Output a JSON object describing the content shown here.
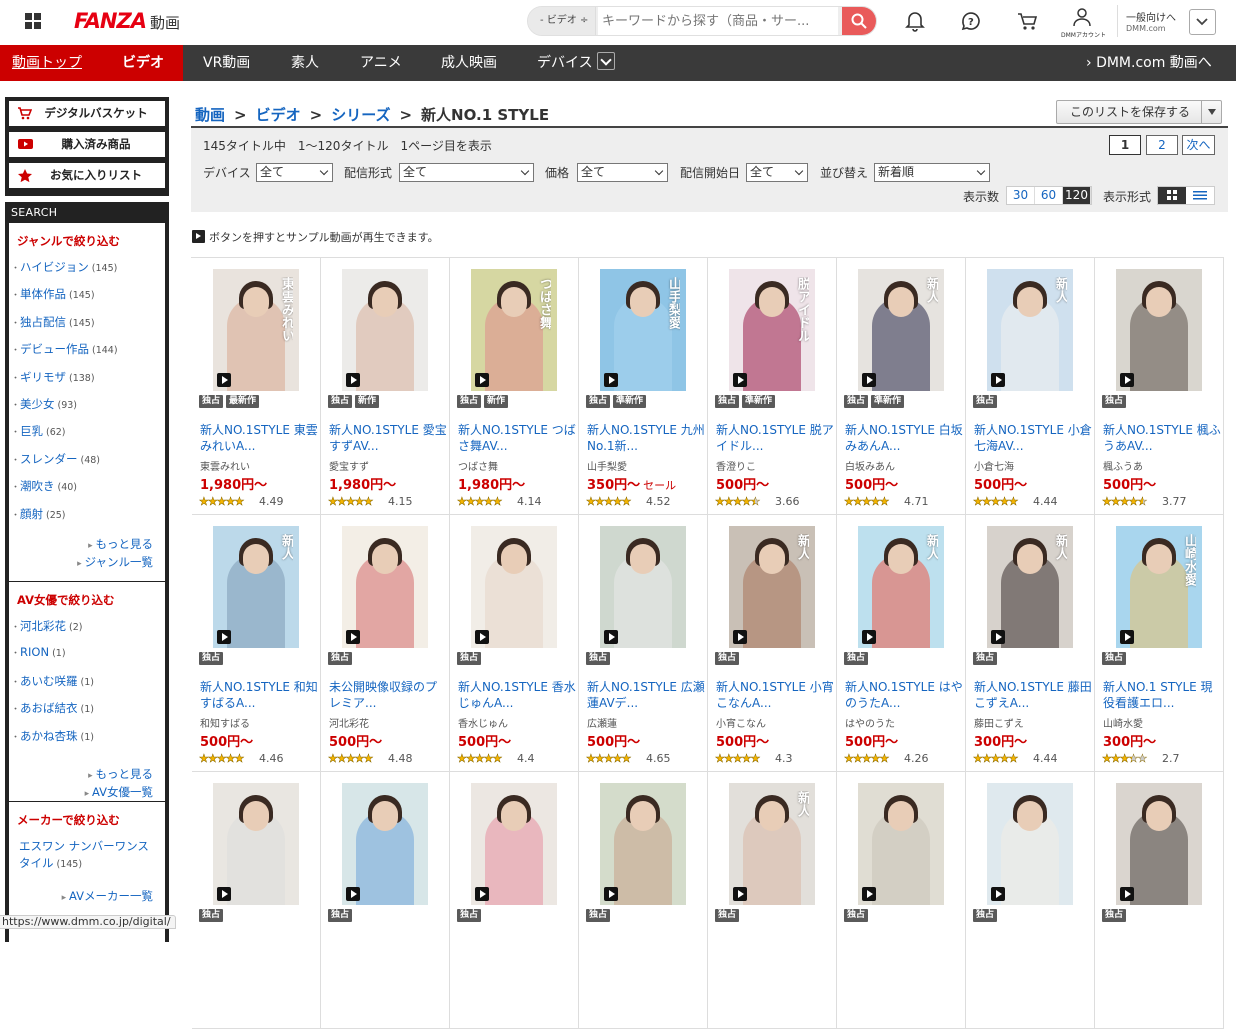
{
  "header": {
    "logo_main": "FANZA",
    "logo_sub": "動画",
    "search_category": "- ビデオ ÷",
    "search_placeholder": "キーワードから探す（商品・サー...",
    "account_label": "DMMアカウント",
    "general_line1": "一般向けへ",
    "general_line2": "DMM.com"
  },
  "nav": {
    "top": "動画トップ",
    "video": "ビデオ",
    "vr": "VR動画",
    "amateur": "素人",
    "anime": "アニメ",
    "adult_film": "成人映画",
    "device": "デバイス",
    "dmm": "DMM.com 動画へ"
  },
  "sidebar": {
    "basket": "デジタルバスケット",
    "purchased": "購入済み商品",
    "favorites": "お気に入りリスト",
    "search_label": "SEARCH",
    "genre_title": "ジャンルで絞り込む",
    "genres": [
      {
        "name": "ハイビジョン",
        "count": "(145)"
      },
      {
        "name": "単体作品",
        "count": "(145)"
      },
      {
        "name": "独占配信",
        "count": "(145)"
      },
      {
        "name": "デビュー作品",
        "count": "(144)"
      },
      {
        "name": "ギリモザ",
        "count": "(138)"
      },
      {
        "name": "美少女",
        "count": "(93)"
      },
      {
        "name": "巨乳",
        "count": "(62)"
      },
      {
        "name": "スレンダー",
        "count": "(48)"
      },
      {
        "name": "潮吹き",
        "count": "(40)"
      },
      {
        "name": "顔射",
        "count": "(25)"
      }
    ],
    "more": "もっと見る",
    "genre_list": "ジャンル一覧",
    "actress_title": "AV女優で絞り込む",
    "actresses": [
      {
        "name": "河北彩花",
        "count": "(2)"
      },
      {
        "name": "RION",
        "count": "(1)"
      },
      {
        "name": "あいむ咲羅",
        "count": "(1)"
      },
      {
        "name": "あおば結衣",
        "count": "(1)"
      },
      {
        "name": "あかね杏珠",
        "count": "(1)"
      }
    ],
    "actress_list": "AV女優一覧",
    "maker_title": "メーカーで絞り込む",
    "maker_name": "エスワン ナンバーワンスタイル",
    "maker_count": "(145)",
    "maker_list": "AVメーカー一覧"
  },
  "breadcrumb": {
    "a": "動画",
    "b": "ビデオ",
    "c": "シリーズ",
    "current": "新人NO.1 STYLE",
    "sep": ">"
  },
  "save_list": "このリストを保存する",
  "count_text": "145タイトル中　1〜120タイトル　1ページ目を表示",
  "pager": {
    "p1": "1",
    "p2": "2",
    "next": "次へ"
  },
  "filters": {
    "device_label": "デバイス",
    "device_val": "全て",
    "format_label": "配信形式",
    "format_val": "全て",
    "price_label": "価格",
    "price_val": "全て",
    "start_label": "配信開始日",
    "start_val": "全て",
    "sort_label": "並び替え",
    "sort_val": "新着順"
  },
  "display": {
    "count_label": "表示数",
    "opts": [
      "30",
      "60",
      "120"
    ],
    "format_label": "表示形式"
  },
  "note": "ボタンを押すとサンプル動画が再生できます。",
  "status_url": "https://www.dmm.co.jp/digital/",
  "products": [
    {
      "title": "新人NO.1STYLE 東雲みれいA...",
      "actress": "東雲みれい",
      "price": "1,980円〜",
      "sale": "",
      "rating": 4.49,
      "rating_text": "4.49",
      "badges": [
        "独占",
        "最新作"
      ],
      "cap": "東雲みれい",
      "bg": "#e9e3dd",
      "tone": "#d9a98f"
    },
    {
      "title": "新人NO.1STYLE 愛宝すずAV...",
      "actress": "愛宝すず",
      "price": "1,980円〜",
      "sale": "",
      "rating": 4.15,
      "rating_text": "4.15",
      "badges": [
        "独占",
        "新作"
      ],
      "cap": "",
      "bg": "#ecebe9",
      "tone": "#d8b19c"
    },
    {
      "title": "新人NO.1STYLE つばさ舞AV...",
      "actress": "つばさ舞",
      "price": "1,980円〜",
      "sale": "",
      "rating": 4.14,
      "rating_text": "4.14",
      "badges": [
        "独占",
        "新作"
      ],
      "cap": "つばさ舞",
      "bg": "#d6d7a2",
      "tone": "#e08c8c"
    },
    {
      "title": "新人NO.1STYLE 九州No.1新...",
      "actress": "山手梨愛",
      "price": "350円〜",
      "sale": "セール",
      "rating": 4.52,
      "rating_text": "4.52",
      "badges": [
        "独占",
        "準新作"
      ],
      "cap": "山手梨愛",
      "bg": "#8fc5e6",
      "tone": "#a8d3ef"
    },
    {
      "title": "新人NO.1STYLE 脱アイドル...",
      "actress": "香澄りこ",
      "price": "500円〜",
      "sale": "",
      "rating": 3.66,
      "rating_text": "3.66",
      "badges": [
        "独占",
        "準新作"
      ],
      "cap": "脱アイドル",
      "bg": "#efe4e9",
      "tone": "#9b1e4b"
    },
    {
      "title": "新人NO.1STYLE 白坂みあんA...",
      "actress": "白坂みあん",
      "price": "500円〜",
      "sale": "",
      "rating": 4.71,
      "rating_text": "4.71",
      "badges": [
        "独占",
        "準新作"
      ],
      "cap": "新人",
      "bg": "#e6e3df",
      "tone": "#2a2c4a"
    },
    {
      "title": "新人NO.1STYLE 小倉七海AV...",
      "actress": "小倉七海",
      "price": "500円〜",
      "sale": "",
      "rating": 4.44,
      "rating_text": "4.44",
      "badges": [
        "独占"
      ],
      "cap": "新人",
      "bg": "#cfe0ee",
      "tone": "#f1f1f1"
    },
    {
      "title": "新人NO.1STYLE 楓ふうあAV...",
      "actress": "楓ふうあ",
      "price": "500円〜",
      "sale": "",
      "rating": 3.77,
      "rating_text": "3.77",
      "badges": [
        "独占"
      ],
      "cap": "",
      "bg": "#d9d6cf",
      "tone": "#5b524a"
    },
    {
      "title": "新人NO.1STYLE 和知すばるA...",
      "actress": "和知すばる",
      "price": "500円〜",
      "sale": "",
      "rating": 4.46,
      "rating_text": "4.46",
      "badges": [
        "独占"
      ],
      "cap": "新人",
      "bg": "#bcd9ea",
      "tone": "#7d9bb5"
    },
    {
      "title": "未公開映像収録のプレミア...",
      "actress": "河北彩花",
      "price": "500円〜",
      "sale": "",
      "rating": 4.48,
      "rating_text": "4.48",
      "badges": [
        "独占"
      ],
      "cap": "",
      "bg": "#f3eee6",
      "tone": "#d46b6b"
    },
    {
      "title": "新人NO.1STYLE 香水じゅんA...",
      "actress": "香水じゅん",
      "price": "500円〜",
      "sale": "",
      "rating": 4.4,
      "rating_text": "4.4",
      "badges": [
        "独占"
      ],
      "cap": "",
      "bg": "#f1ede7",
      "tone": "#e6d6c9"
    },
    {
      "title": "新人NO.1STYLE 広瀬蓮AVデ...",
      "actress": "広瀬蓮",
      "price": "500円〜",
      "sale": "",
      "rating": 4.65,
      "rating_text": "4.65",
      "badges": [
        "独占"
      ],
      "cap": "",
      "bg": "#cfd8cf",
      "tone": "#eaeaea"
    },
    {
      "title": "新人NO.1STYLE 小宵こなんA...",
      "actress": "小宵こなん",
      "price": "500円〜",
      "sale": "",
      "rating": 4.3,
      "rating_text": "4.3",
      "badges": [
        "独占"
      ],
      "cap": "新人",
      "bg": "#c9c0b6",
      "tone": "#a7735a"
    },
    {
      "title": "新人NO.1STYLE はやのうたA...",
      "actress": "はやのうた",
      "price": "500円〜",
      "sale": "",
      "rating": 4.26,
      "rating_text": "4.26",
      "badges": [
        "独占"
      ],
      "cap": "新人",
      "bg": "#bde0ee",
      "tone": "#ee5a48"
    },
    {
      "title": "新人NO.1STYLE 藤田こずえA...",
      "actress": "藤田こずえ",
      "price": "300円〜",
      "sale": "",
      "rating": 4.44,
      "rating_text": "4.44",
      "badges": [
        "独占"
      ],
      "cap": "新人",
      "bg": "#d7d2cc",
      "tone": "#3a3030"
    },
    {
      "title": "新人NO.1 STYLE 現役看護エロ...",
      "actress": "山崎水愛",
      "price": "300円〜",
      "sale": "",
      "rating": 2.7,
      "rating_text": "2.7",
      "badges": [
        "独占"
      ],
      "cap": "山崎水愛",
      "bg": "#a9d6ee",
      "tone": "#e7c16e"
    },
    {
      "title": "",
      "actress": "",
      "price": "",
      "sale": "",
      "rating": 0,
      "rating_text": "",
      "badges": [
        "独占"
      ],
      "cap": "",
      "bg": "#e9e6e1",
      "tone": "#dcdcdc"
    },
    {
      "title": "",
      "actress": "",
      "price": "",
      "sale": "",
      "rating": 0,
      "rating_text": "",
      "badges": [
        "独占"
      ],
      "cap": "",
      "bg": "#d7e6e8",
      "tone": "#6fa4d8"
    },
    {
      "title": "",
      "actress": "",
      "price": "",
      "sale": "",
      "rating": 0,
      "rating_text": "",
      "badges": [
        "独占"
      ],
      "cap": "",
      "bg": "#ece7e2",
      "tone": "#e88fa0"
    },
    {
      "title": "",
      "actress": "",
      "price": "",
      "sale": "",
      "rating": 0,
      "rating_text": "",
      "badges": [
        "独占"
      ],
      "cap": "",
      "bg": "#d4dccb",
      "tone": "#c7a38a"
    },
    {
      "title": "",
      "actress": "",
      "price": "",
      "sale": "",
      "rating": 0,
      "rating_text": "",
      "badges": [
        "独占"
      ],
      "cap": "新人",
      "bg": "#e2dfda",
      "tone": "#d9b7a5"
    },
    {
      "title": "",
      "actress": "",
      "price": "",
      "sale": "",
      "rating": 0,
      "rating_text": "",
      "badges": [
        "独占"
      ],
      "cap": "",
      "bg": "#e0ddd3",
      "tone": "#c9c2b8"
    },
    {
      "title": "",
      "actress": "",
      "price": "",
      "sale": "",
      "rating": 0,
      "rating_text": "",
      "badges": [
        "独占"
      ],
      "cap": "",
      "bg": "#dfe9ee",
      "tone": "#f0ece6"
    },
    {
      "title": "",
      "actress": "",
      "price": "",
      "sale": "",
      "rating": 0,
      "rating_text": "",
      "badges": [
        "独占"
      ],
      "cap": "",
      "bg": "#dad5cf",
      "tone": "#4a4440"
    }
  ],
  "colors": {
    "accent_red": "#cc0000",
    "nav_bg": "#3a3a3a",
    "link": "#1565c0"
  }
}
